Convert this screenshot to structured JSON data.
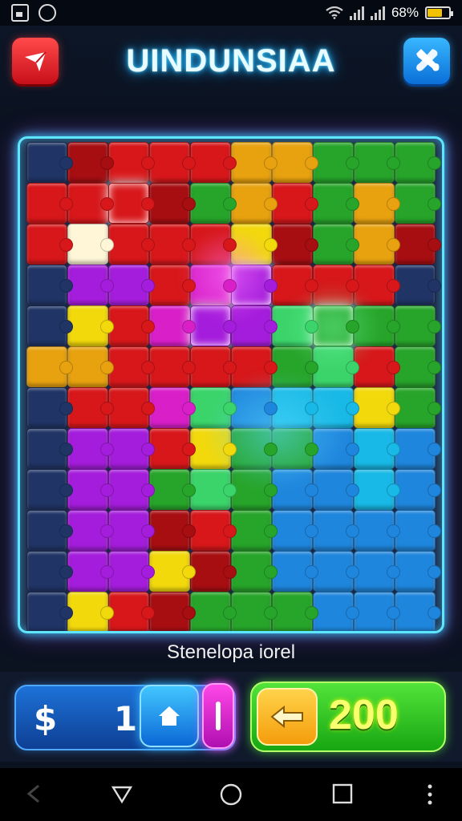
{
  "status_bar": {
    "battery_text": "68%",
    "battery_level": 0.68,
    "icons": [
      "image-icon",
      "settings-circle-icon",
      "wifi-icon",
      "signal-icon",
      "signal-icon",
      "battery-icon"
    ]
  },
  "header": {
    "title": "UINDUNSIAA",
    "left_button_icon": "back-arrow-icon",
    "right_button_icon": "tools-icon"
  },
  "board": {
    "columns": 10,
    "rows": 12,
    "palette": {
      "R": "#d7171a",
      "D": "#a70e12",
      "O": "#e8a20f",
      "Y": "#f2d90c",
      "G": "#27a52a",
      "L": "#3bd46a",
      "B": "#1f86dd",
      "C": "#18b9e6",
      "P": "#a51ddc",
      "M": "#d81fc8",
      "N": "#203566",
      "W": "#fff6d8"
    },
    "pieces": [
      "NDRRROOGGG",
      "RRRDGORGOG",
      "RWRRRYDGOD",
      "NPPRMPRRRN",
      "NYRMPPLGGG",
      "OORRRRGLRG",
      "NRRMLBCCYG",
      "NPPRYGGBCB",
      "NPPGLGBBCB",
      "NPPDRGBBBB",
      "NPPYDGBBBB",
      "NYRDGGGBBB"
    ],
    "glowing": [
      [
        2,
        1
      ],
      [
        4,
        4
      ],
      [
        5,
        3
      ],
      [
        7,
        4
      ],
      [
        10,
        4
      ]
    ]
  },
  "status_caption": "Stenelopa iorel",
  "bottom_bar": {
    "currency_symbol": "$",
    "coin_count": "1",
    "home_icon": "home-icon",
    "score": "200",
    "arrow_icon": "left-arrow-icon"
  },
  "nav_bar": {
    "icons": [
      "nav-back-icon",
      "nav-triangle-icon",
      "nav-home-circle-icon",
      "nav-recents-icon",
      "nav-more-icon"
    ]
  }
}
